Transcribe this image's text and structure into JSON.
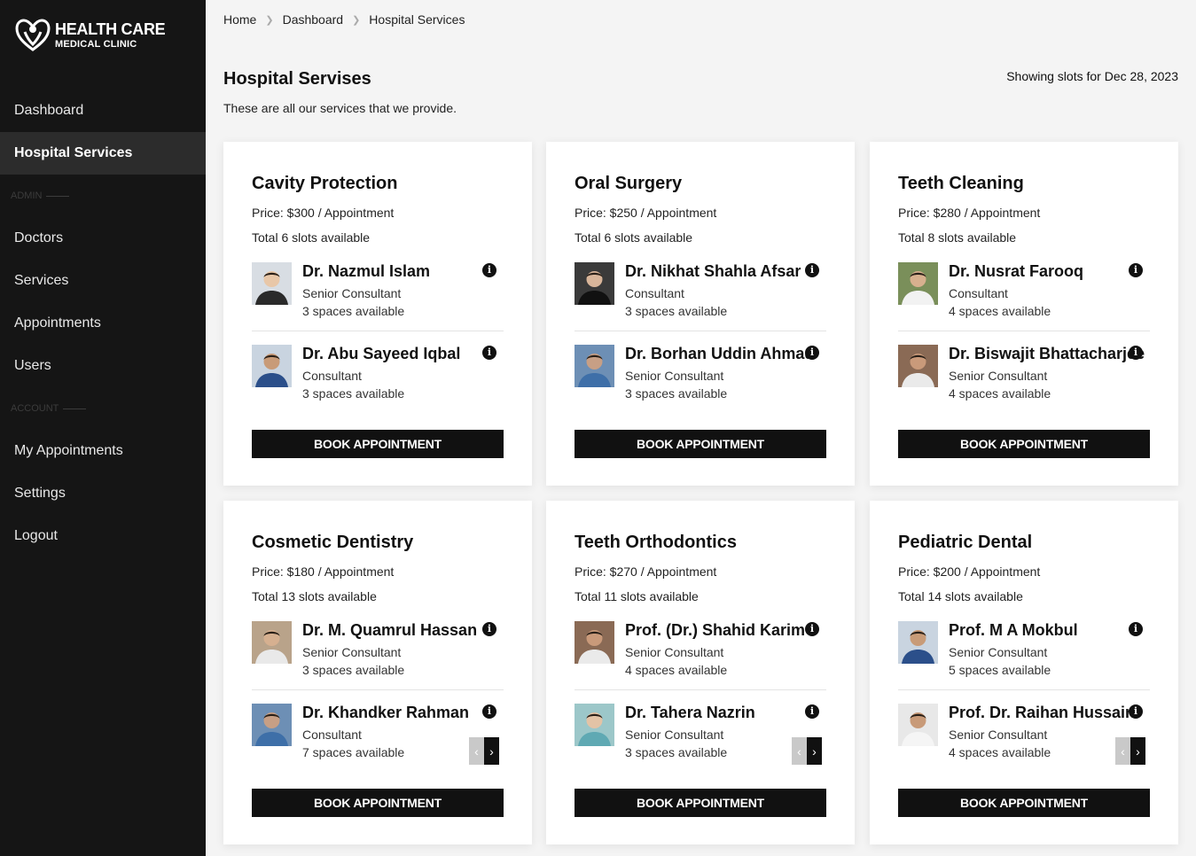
{
  "brand": {
    "title": "HEALTH CARE",
    "subtitle": "MEDICAL CLINIC"
  },
  "sidebar": {
    "items": [
      {
        "label": "Dashboard",
        "active": false
      },
      {
        "label": "Hospital Services",
        "active": true
      },
      {
        "section": "ADMIN"
      },
      {
        "label": "Doctors",
        "active": false
      },
      {
        "label": "Services",
        "active": false
      },
      {
        "label": "Appointments",
        "active": false
      },
      {
        "label": "Users",
        "active": false
      },
      {
        "section": "ACCOUNT"
      },
      {
        "label": "My Appointments",
        "active": false
      },
      {
        "label": "Settings",
        "active": false
      },
      {
        "label": "Logout",
        "active": false
      }
    ]
  },
  "breadcrumb": [
    "Home",
    "Dashboard",
    "Hospital Services"
  ],
  "page": {
    "title": "Hospital Servises",
    "description": "These are all our services that we provide.",
    "slot_date": "Showing slots for Dec 28, 2023"
  },
  "book_label": "BOOK APPOINTMENT",
  "services": [
    {
      "title": "Cavity Protection",
      "price": "Price: $300 / Appointment",
      "total": "Total 6 slots available",
      "carousel": false,
      "doctors": [
        {
          "name": "Dr. Nazmul Islam",
          "title": "Senior Consultant",
          "spaces": "3 spaces available",
          "photo": "p1"
        },
        {
          "name": "Dr. Abu Sayeed Iqbal",
          "title": "Consultant",
          "spaces": "3 spaces available",
          "photo": "p2"
        }
      ]
    },
    {
      "title": "Oral Surgery",
      "price": "Price: $250 / Appointment",
      "total": "Total 6 slots available",
      "carousel": false,
      "doctors": [
        {
          "name": "Dr. Nikhat Shahla Afsar",
          "title": "Consultant",
          "spaces": "3 spaces available",
          "photo": "p3"
        },
        {
          "name": "Dr. Borhan Uddin Ahmad",
          "title": "Senior Consultant",
          "spaces": "3 spaces available",
          "photo": "p4"
        }
      ]
    },
    {
      "title": "Teeth Cleaning",
      "price": "Price: $280 / Appointment",
      "total": "Total 8 slots available",
      "carousel": false,
      "doctors": [
        {
          "name": "Dr. Nusrat Farooq",
          "title": "Consultant",
          "spaces": "4 spaces available",
          "photo": "p5"
        },
        {
          "name": "Dr. Biswajit Bhattacharjee",
          "title": "Senior Consultant",
          "spaces": "4 spaces available",
          "photo": "p6"
        }
      ]
    },
    {
      "title": "Cosmetic Dentistry",
      "price": "Price: $180 / Appointment",
      "total": "Total 13 slots available",
      "carousel": true,
      "doctors": [
        {
          "name": "Dr. M. Quamrul Hassan",
          "title": "Senior Consultant",
          "spaces": "3 spaces available",
          "photo": "p7"
        },
        {
          "name": "Dr. Khandker Rahman",
          "title": "Consultant",
          "spaces": "7 spaces available",
          "photo": "p4"
        }
      ]
    },
    {
      "title": "Teeth Orthodontics",
      "price": "Price: $270 / Appointment",
      "total": "Total 11 slots available",
      "carousel": true,
      "doctors": [
        {
          "name": "Prof. (Dr.) Shahid Karim",
          "title": "Senior Consultant",
          "spaces": "4 spaces available",
          "photo": "p6"
        },
        {
          "name": "Dr. Tahera Nazrin",
          "title": "Senior Consultant",
          "spaces": "3 spaces available",
          "photo": "p8"
        }
      ]
    },
    {
      "title": "Pediatric Dental",
      "price": "Price: $200 / Appointment",
      "total": "Total 14 slots available",
      "carousel": true,
      "doctors": [
        {
          "name": "Prof. M A Mokbul",
          "title": "Senior Consultant",
          "spaces": "5 spaces available",
          "photo": "p2"
        },
        {
          "name": "Prof. Dr. Raihan Hussain",
          "title": "Senior Consultant",
          "spaces": "4 spaces available",
          "photo": "p9"
        }
      ]
    }
  ]
}
